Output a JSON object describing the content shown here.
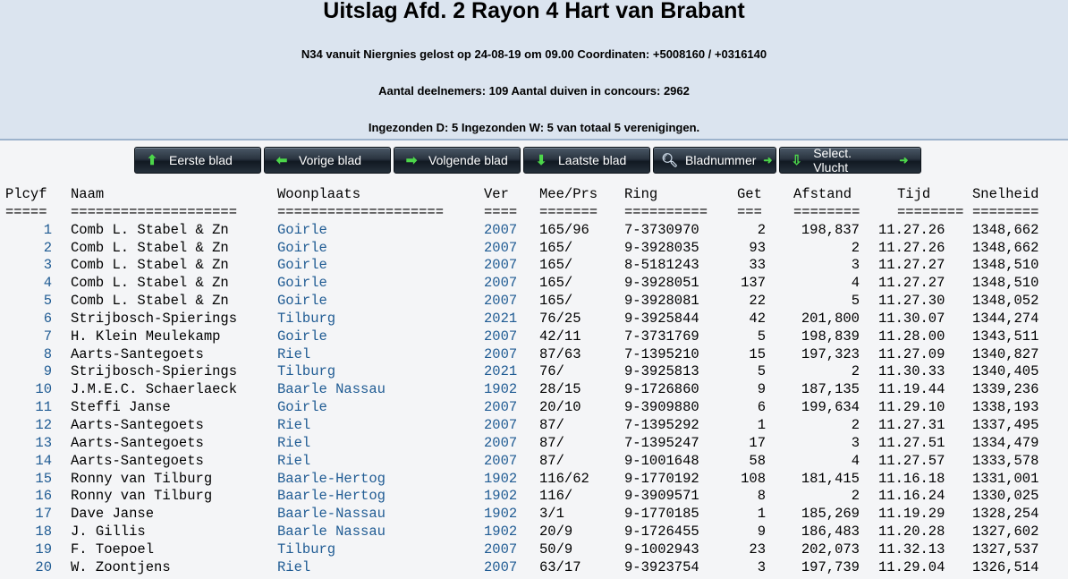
{
  "header": {
    "title": "Uitslag Afd. 2 Rayon 4 Hart van Brabant",
    "line1": "N34 vanuit Niergnies gelost op 24-08-19 om 09.00 Coordinaten: +5008160 / +0316140",
    "line2": "Aantal deelnemers: 109 Aantal duiven in concours: 2962",
    "line3": "Ingezonden D: 5 Ingezonden W: 5 van totaal 5 verenigingen."
  },
  "nav": {
    "first": "Eerste blad",
    "prev": "Vorige blad",
    "next": "Volgende blad",
    "last": "Laatste blad",
    "page": "Bladnummer",
    "select": "Select. Vlucht"
  },
  "columns": {
    "plcyf": "Plcyf",
    "naam": "Naam",
    "woonplaats": "Woonplaats",
    "ver": "Ver",
    "meeprs": "Mee/Prs",
    "ring": "Ring",
    "get": "Get",
    "afstand": "Afstand",
    "tijd": "Tijd",
    "snelheid": "Snelheid"
  },
  "underlines": {
    "plcyf": "=====",
    "naam": "====================",
    "woonplaats": "====================",
    "ver": "====",
    "meeprs": "=======",
    "ring": "==========",
    "get": "===",
    "afstand": "========",
    "tijd": "========",
    "snelheid": "========"
  },
  "rows": [
    [
      "1",
      "Comb L. Stabel & Zn",
      "Goirle",
      "2007",
      "165/96",
      "7-3730970",
      "2",
      "198,837",
      "11.27.26",
      "1348,662"
    ],
    [
      "2",
      "Comb L. Stabel & Zn",
      "Goirle",
      "2007",
      "165/",
      "9-3928035",
      "93",
      "2",
      "11.27.26",
      "1348,662"
    ],
    [
      "3",
      "Comb L. Stabel & Zn",
      "Goirle",
      "2007",
      "165/",
      "8-5181243",
      "33",
      "3",
      "11.27.27",
      "1348,510"
    ],
    [
      "4",
      "Comb L. Stabel & Zn",
      "Goirle",
      "2007",
      "165/",
      "9-3928051",
      "137",
      "4",
      "11.27.27",
      "1348,510"
    ],
    [
      "5",
      "Comb L. Stabel & Zn",
      "Goirle",
      "2007",
      "165/",
      "9-3928081",
      "22",
      "5",
      "11.27.30",
      "1348,052"
    ],
    [
      "6",
      "Strijbosch-Spierings",
      "Tilburg",
      "2021",
      "76/25",
      "9-3925844",
      "42",
      "201,800",
      "11.30.07",
      "1344,274"
    ],
    [
      "7",
      "H. Klein Meulekamp",
      "Goirle",
      "2007",
      "42/11",
      "7-3731769",
      "5",
      "198,839",
      "11.28.00",
      "1343,511"
    ],
    [
      "8",
      "Aarts-Santegoets",
      "Riel",
      "2007",
      "87/63",
      "7-1395210",
      "15",
      "197,323",
      "11.27.09",
      "1340,827"
    ],
    [
      "9",
      "Strijbosch-Spierings",
      "Tilburg",
      "2021",
      "76/",
      "9-3925813",
      "5",
      "2",
      "11.30.33",
      "1340,405"
    ],
    [
      "10",
      "J.M.E.C. Schaerlaeck",
      "Baarle Nassau",
      "1902",
      "28/15",
      "9-1726860",
      "9",
      "187,135",
      "11.19.44",
      "1339,236"
    ],
    [
      "11",
      "Steffi Janse",
      "Goirle",
      "2007",
      "20/10",
      "9-3909880",
      "6",
      "199,634",
      "11.29.10",
      "1338,193"
    ],
    [
      "12",
      "Aarts-Santegoets",
      "Riel",
      "2007",
      "87/",
      "7-1395292",
      "1",
      "2",
      "11.27.31",
      "1337,495"
    ],
    [
      "13",
      "Aarts-Santegoets",
      "Riel",
      "2007",
      "87/",
      "7-1395247",
      "17",
      "3",
      "11.27.51",
      "1334,479"
    ],
    [
      "14",
      "Aarts-Santegoets",
      "Riel",
      "2007",
      "87/",
      "9-1001648",
      "58",
      "4",
      "11.27.57",
      "1333,578"
    ],
    [
      "15",
      "Ronny van Tilburg",
      "Baarle-Hertog",
      "1902",
      "116/62",
      "9-1770192",
      "108",
      "181,415",
      "11.16.18",
      "1331,001"
    ],
    [
      "16",
      "Ronny van Tilburg",
      "Baarle-Hertog",
      "1902",
      "116/",
      "9-3909571",
      "8",
      "2",
      "11.16.24",
      "1330,025"
    ],
    [
      "17",
      "Dave Janse",
      "Baarle-Nassau",
      "1902",
      "3/1",
      "9-1770185",
      "1",
      "185,269",
      "11.19.29",
      "1328,254"
    ],
    [
      "18",
      "J. Gillis",
      "Baarle Nassau",
      "1902",
      "20/9",
      "9-1726455",
      "9",
      "186,483",
      "11.20.28",
      "1327,602"
    ],
    [
      "19",
      "F. Toepoel",
      "Tilburg",
      "2007",
      "50/9",
      "9-1002943",
      "23",
      "202,073",
      "11.32.13",
      "1327,537"
    ],
    [
      "20",
      "W. Zoontjens",
      "Riel",
      "2007",
      "63/17",
      "9-3923754",
      "3",
      "197,739",
      "11.29.04",
      "1326,514"
    ]
  ],
  "colors": {
    "link": "#1f5b93",
    "header_bg": "#dbe4ef",
    "button_icon": "#4cd64a"
  },
  "icons": {
    "first": "arrow-up-icon",
    "prev": "arrow-left-icon",
    "next": "arrow-right-icon",
    "last": "arrow-down-icon",
    "page": "magnifier-icon",
    "select": "download-icon"
  }
}
